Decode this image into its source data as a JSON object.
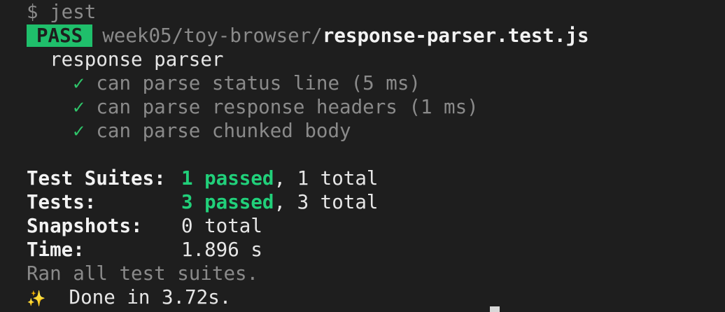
{
  "prompt": {
    "symbol": "$",
    "command": "jest"
  },
  "result": {
    "badge": "PASS",
    "path_dir": "week05/toy-browser/",
    "path_file": "response-parser.test.js"
  },
  "suite": {
    "name": "response parser",
    "tests": [
      {
        "check": "✓",
        "label": "can parse status line",
        "duration": "(5 ms)"
      },
      {
        "check": "✓",
        "label": "can parse response headers",
        "duration": "(1 ms)"
      },
      {
        "check": "✓",
        "label": "can parse chunked body",
        "duration": ""
      }
    ]
  },
  "summary": {
    "suites_label": "Test Suites:",
    "suites_passed": "1 passed",
    "suites_total": ", 1 total",
    "tests_label": "Tests:",
    "tests_passed": "3 passed",
    "tests_total": ", 3 total",
    "snapshots_label": "Snapshots:",
    "snapshots_value": "0 total",
    "time_label": "Time:",
    "time_value": "1.896 s"
  },
  "footer": {
    "ran_all": "Ran all test suites.",
    "done_icon": "✨",
    "done_text": "Done in 3.72s."
  },
  "colors": {
    "background": "#1e1e1e",
    "pass_badge": "#1fbf6b",
    "success_green": "#21d07a",
    "dim_text": "#8a8a8a"
  }
}
